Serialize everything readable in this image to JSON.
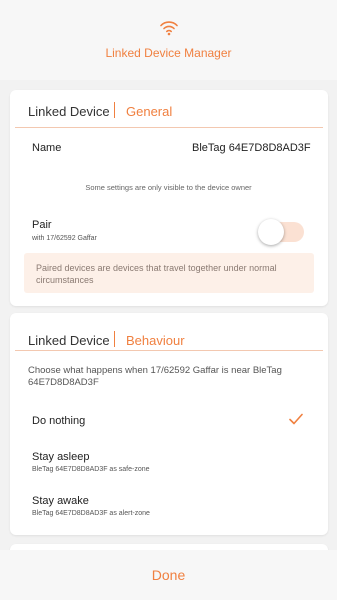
{
  "header": {
    "title": "Linked Device Manager",
    "icon": "wifi-icon",
    "accent_color": "#f08040"
  },
  "general_card": {
    "title": "Linked Device",
    "section": "General",
    "name_label": "Name",
    "name_value": "BleTag 64E7D8D8AD3F",
    "owner_note": "Some settings are only visible to the device owner",
    "pair_label": "Pair",
    "pair_sub": "with 17/62592 Gaffar",
    "pair_enabled": false,
    "info_text": "Paired devices are devices that travel together under normal circumstances"
  },
  "behaviour_card": {
    "title": "Linked Device",
    "section": "Behaviour",
    "description": "Choose what happens when 17/62592 Gaffar is near BleTag 64E7D8D8AD3F",
    "options": [
      {
        "label": "Do nothing",
        "sub": "",
        "selected": true
      },
      {
        "label": "Stay asleep",
        "sub": "BleTag 64E7D8D8AD3F as safe-zone",
        "selected": false
      },
      {
        "label": "Stay awake",
        "sub": "BleTag 64E7D8D8AD3F as alert-zone",
        "selected": false
      }
    ]
  },
  "footer": {
    "done_label": "Done"
  }
}
